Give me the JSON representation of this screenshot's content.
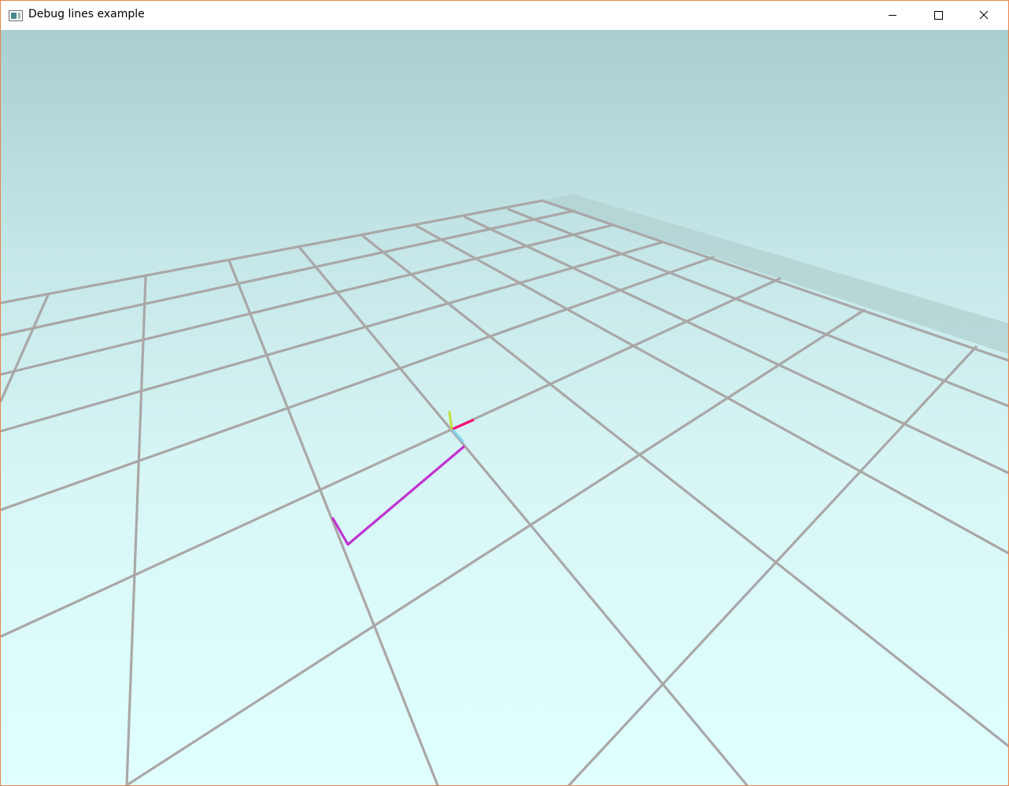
{
  "window": {
    "title": "Debug lines example",
    "controls": {
      "minimize": "minimize-icon",
      "maximize": "maximize-icon",
      "close": "close-icon"
    }
  },
  "scene": {
    "grid_color": "#aaa7a7",
    "sky_top_color": "#a9cfd1",
    "sky_bottom_color": "#e0ffff",
    "axis_colors": {
      "x": "#ff0a78",
      "y": "#c0e23c",
      "z": "#7fd8ee"
    },
    "debug_line_color": "#c032d0"
  }
}
